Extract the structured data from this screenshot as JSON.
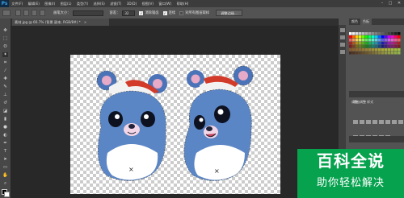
{
  "app": {
    "logo": "Ps"
  },
  "menu": [
    "文件(F)",
    "编辑(E)",
    "图像(I)",
    "图层(L)",
    "类型(Y)",
    "选择(S)",
    "滤镜(T)",
    "3D(D)",
    "视图(V)",
    "窗口(W)",
    "帮助(H)"
  ],
  "window_controls": {
    "minimize": "–",
    "maximize": "□",
    "close": "✕"
  },
  "options": {
    "brush_size_label": "画笔大小：",
    "brush_size_value": "",
    "hardness_label": "容差：",
    "hardness_value": "32",
    "antialias_label": "消除锯齿",
    "contiguous_label": "连续",
    "sample_all_label": "对所有图层取样",
    "refine_edge_button": "调整边缘..."
  },
  "document": {
    "tab_title": "素材.jpg @ 66.7% (背景 副本, RGB/8#) *",
    "close": "×"
  },
  "panels": {
    "tabs": [
      "颜色",
      "色板"
    ],
    "adjust_tabs": [
      "调整",
      "样式"
    ],
    "add_adjustment_label": "添加调整"
  },
  "watermark": {
    "title": "百科全说",
    "subtitle": "助你轻松解决"
  },
  "colors": {
    "selection_body": "#5b86c6",
    "belly": "#ffffff",
    "hat_red": "#d23a2a"
  }
}
